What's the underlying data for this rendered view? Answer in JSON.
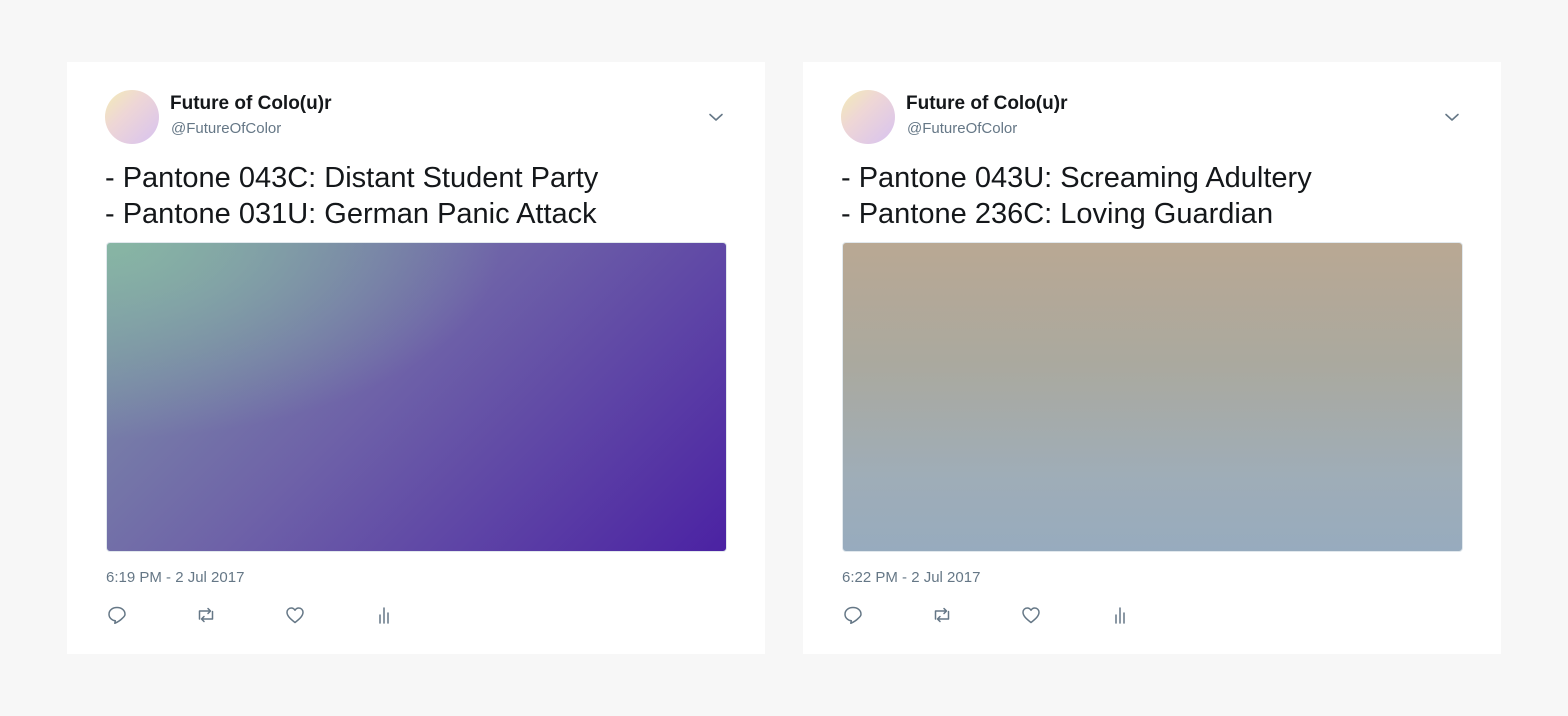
{
  "tweets": [
    {
      "author_name": "Future of Colo(u)r",
      "author_handle": "@FutureOfColor",
      "lines": [
        "- Pantone 043C: Distant Student Party",
        "- Pantone 031U: German Panic Attack"
      ],
      "media_gradient": [
        "#8ab8a4",
        "#7e93a8",
        "#6e62a8",
        "#4b22a3"
      ],
      "timestamp": "6:19 PM - 2 Jul 2017"
    },
    {
      "author_name": "Future of Colo(u)r",
      "author_handle": "@FutureOfColor",
      "lines": [
        "- Pantone 043U: Screaming Adultery",
        "- Pantone 236C: Loving Guardian"
      ],
      "media_gradient": [
        "#b9a893",
        "#aaa99f",
        "#9fadb7",
        "#97abbe"
      ],
      "timestamp": "6:22 PM - 2 Jul 2017"
    }
  ],
  "colors": {
    "page_background": "#f7f7f7",
    "card_background": "#ffffff",
    "text_primary": "#14171a",
    "text_secondary": "#657786",
    "icon": "#657786"
  },
  "icons": {
    "menu": "chevron-down-icon",
    "reply": "reply-icon",
    "retweet": "retweet-icon",
    "like": "heart-icon",
    "analytics": "analytics-icon"
  }
}
